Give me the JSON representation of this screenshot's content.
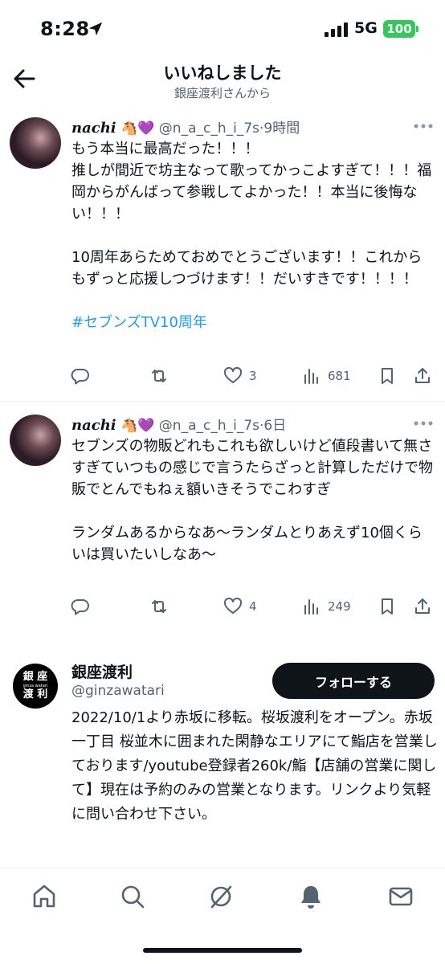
{
  "status_bar": {
    "time": "8:28",
    "network": "5G",
    "battery": "100"
  },
  "header": {
    "title": "いいねしました",
    "subtitle": "銀座渡利さんから"
  },
  "tweets": [
    {
      "name": "nachi",
      "emoji": "🐴💜",
      "handle": "@n_a_c_h_i_7s",
      "time": "·9時間",
      "text": "もう本当に最高だった！！！\n推しが間近で坊主なって歌ってかっこよすぎて！！！福岡からがんばって参戦してよかった！！本当に後悔ない！！！\n\n10周年あらためておめでとうございます！！これからもずっと応援しつづけます！！だいすきです！！！！\n\n",
      "hashtag": "#セブンズTV10周年",
      "likes": "3",
      "views": "681"
    },
    {
      "name": "nachi",
      "emoji": "🐴💜",
      "handle": "@n_a_c_h_i_7s",
      "time": "·6日",
      "text": "セブンズの物販どれもこれも欲しいけど値段書いて無さすぎていつもの感じで言うたらざっと計算しただけで物販でとんでもねぇ額いきそうでこわすぎ\n\nランダムあるからなあ〜ランダムとりあえず10個くらいは買いたいしなあ〜",
      "likes": "4",
      "views": "249"
    }
  ],
  "profile": {
    "logo_line1": "銀 座",
    "logo_small": "ginza watari",
    "logo_line2": "渡 利",
    "name": "銀座渡利",
    "handle": "@ginzawatari",
    "follow_label": "フォローする",
    "bio": "2022/10/1より赤坂に移転。桜坂渡利をオープン。赤坂一丁目 桜並木に囲まれた閑静なエリアにて鮨店を営業しております/youtube登録者260k/鮨【店舗の営業に関して】現在は予約のみの営業となります。リンクより気軽に問い合わせ下さい。"
  },
  "bottom_nav": [
    "home-icon",
    "search-icon",
    "grok-icon",
    "notifications-icon",
    "messages-icon"
  ]
}
